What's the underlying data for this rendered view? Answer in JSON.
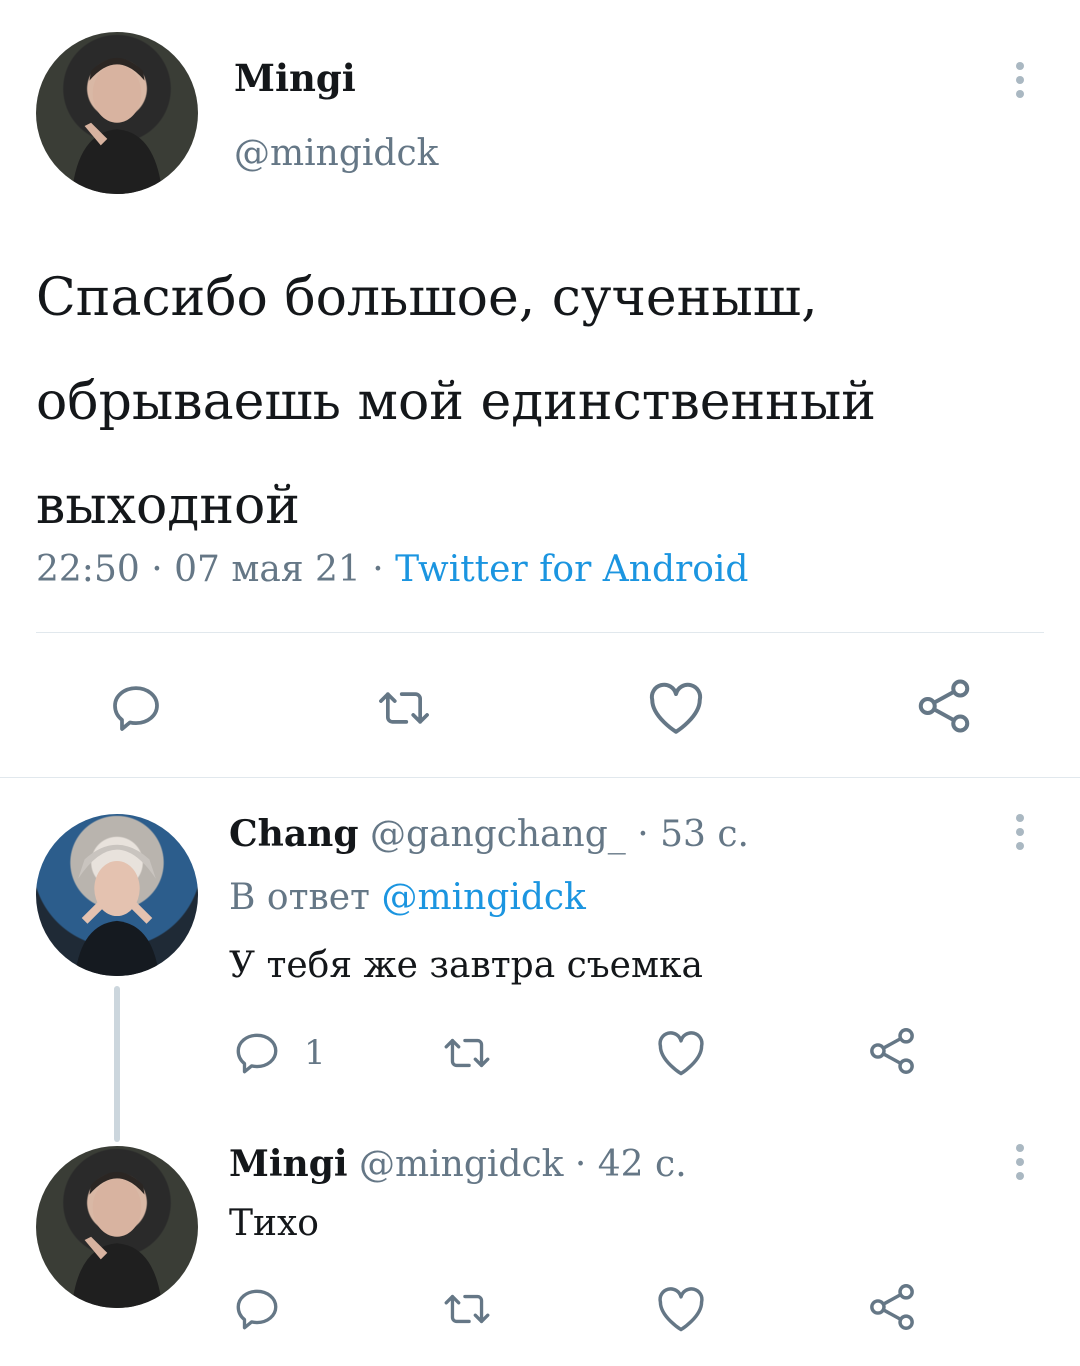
{
  "main_tweet": {
    "author_name": "Mingi",
    "author_handle": "@mingidck",
    "text_line1": "Спасибо большое, сученыш,",
    "text_line2": "обрываешь мой единственный",
    "text_line3": "выходной",
    "time": "22:50",
    "date": "07 мая 21",
    "separator": "·",
    "source": "Twitter for Android"
  },
  "reply1": {
    "author_name": "Chang",
    "author_handle": "@gangchang_",
    "separator": "·",
    "age": "53 с.",
    "reply_to_prefix": "В ответ",
    "reply_to_handle": "@mingidck",
    "text": "У тебя же завтра съемка",
    "reply_count": "1"
  },
  "reply2": {
    "author_name": "Mingi",
    "author_handle": "@mingidck",
    "separator": "·",
    "age": "42 с.",
    "text": "Тихо"
  },
  "icons": {
    "reply": "reply-icon",
    "retweet": "retweet-icon",
    "like": "heart-icon",
    "share": "share-icon",
    "more": "more-vertical-icon"
  },
  "colors": {
    "link": "#1b95e0",
    "muted": "#657786",
    "icon": "#657786",
    "thread_line": "#ccd6dd"
  }
}
